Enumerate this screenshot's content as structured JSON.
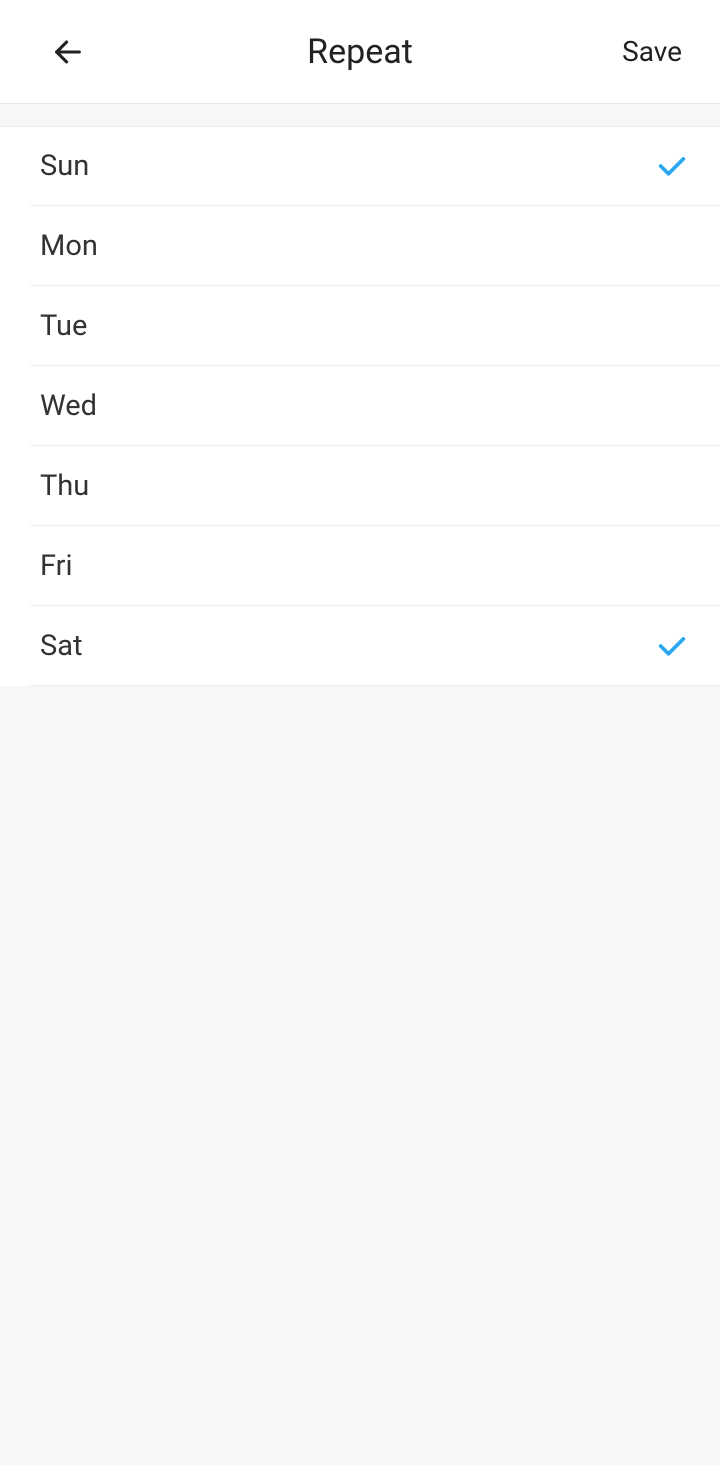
{
  "header": {
    "title": "Repeat",
    "save_label": "Save"
  },
  "days": [
    {
      "label": "Sun",
      "selected": true
    },
    {
      "label": "Mon",
      "selected": false
    },
    {
      "label": "Tue",
      "selected": false
    },
    {
      "label": "Wed",
      "selected": false
    },
    {
      "label": "Thu",
      "selected": false
    },
    {
      "label": "Fri",
      "selected": false
    },
    {
      "label": "Sat",
      "selected": true
    }
  ],
  "colors": {
    "check": "#2aa7f3"
  }
}
